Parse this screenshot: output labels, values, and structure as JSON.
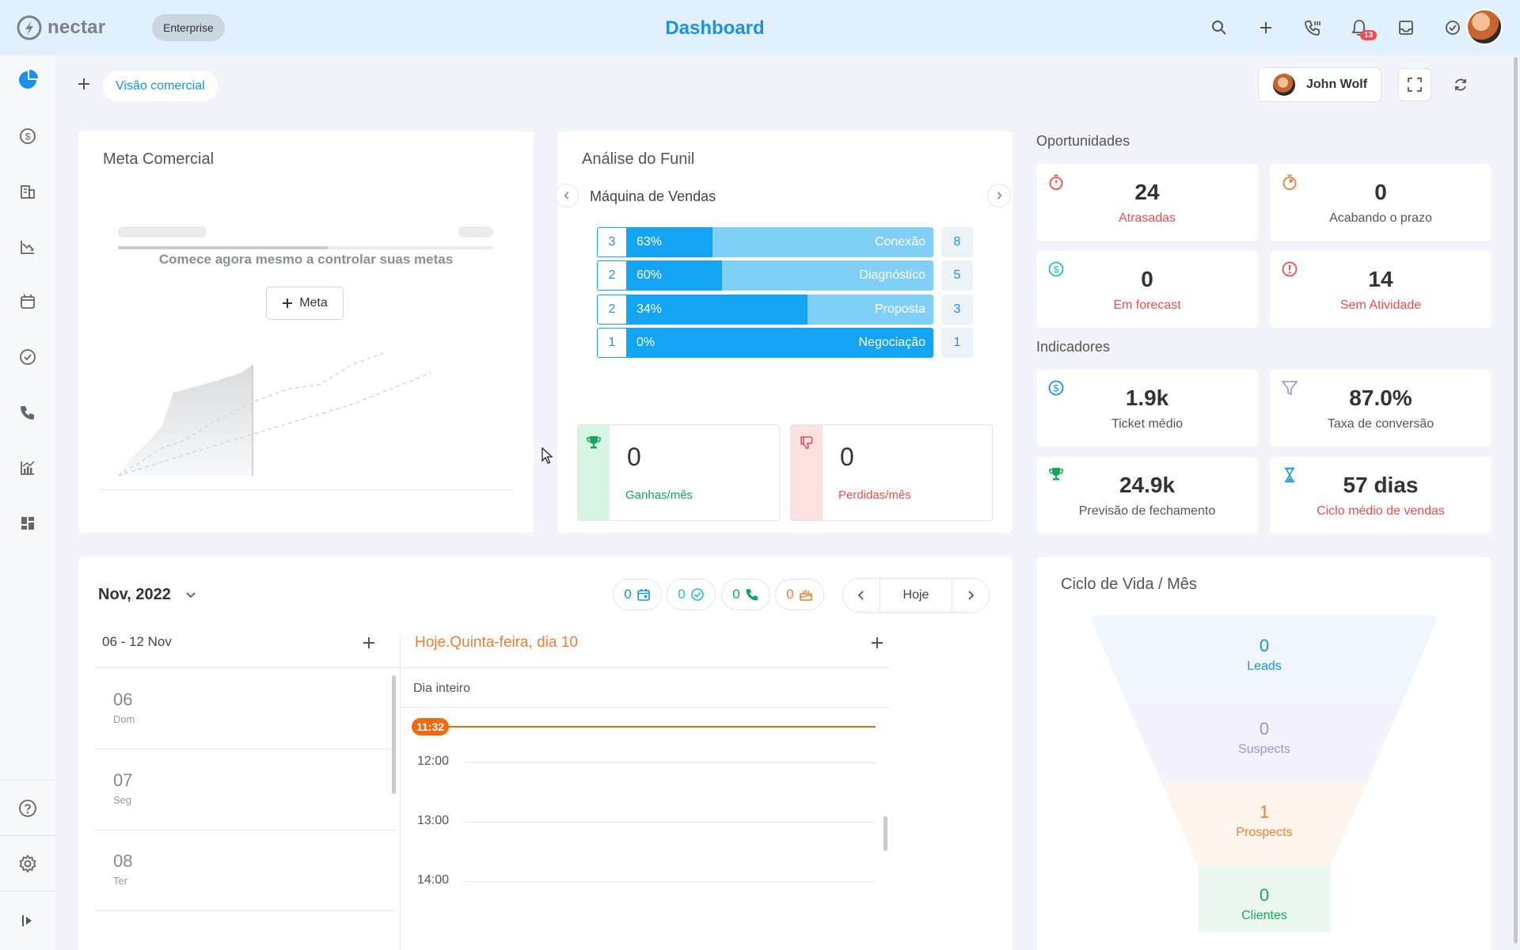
{
  "app": {
    "brand": "nectar",
    "plan_badge": "Enterprise",
    "title": "Dashboard",
    "notifications_count": "13",
    "accent_color": "#1a91e6"
  },
  "toolbar": {
    "tab_label": "Visão comercial",
    "user_name": "John Wolf"
  },
  "sidebar": {
    "items": [
      "pie-chart-icon",
      "dollar-icon",
      "building-icon",
      "chart-down-icon",
      "calendar-icon",
      "check-circle-icon",
      "phone-icon",
      "chart-up-icon",
      "dashboard-icon"
    ],
    "bottom": [
      "help-icon",
      "gear-icon",
      "collapse-icon"
    ]
  },
  "meta_comercial": {
    "title": "Meta Comercial",
    "message": "Comece agora mesmo a controlar suas metas",
    "button_label": "Meta",
    "progress": 0.56
  },
  "funnel": {
    "title": "Análise do Funil",
    "pipeline": "Máquina de Vendas",
    "stages": [
      {
        "num": "3",
        "pct": "63%",
        "fill": 0.28,
        "name": "Conexão",
        "count": "8"
      },
      {
        "num": "2",
        "pct": "60%",
        "fill": 0.31,
        "name": "Diagnóstico",
        "count": "5"
      },
      {
        "num": "2",
        "pct": "34%",
        "fill": 0.59,
        "name": "Proposta",
        "count": "3"
      },
      {
        "num": "1",
        "pct": "0%",
        "fill": 1.0,
        "name": "Negociação",
        "count": "1"
      }
    ],
    "won": {
      "value": "0",
      "label": "Ganhas/mês"
    },
    "lost": {
      "value": "0",
      "label": "Perdidas/mês"
    }
  },
  "oportunidades": {
    "title": "Oportunidades",
    "tiles": [
      {
        "value": "24",
        "label": "Atrasadas",
        "color": "#f04e4e",
        "icon": "timer-icon"
      },
      {
        "value": "0",
        "label": "Acabando o prazo",
        "color": "#555555",
        "icon": "stopwatch-icon"
      },
      {
        "value": "0",
        "label": "Em forecast",
        "color": "#f04e4e",
        "icon": "dollar-circle-icon"
      },
      {
        "value": "14",
        "label": "Sem Atividade",
        "color": "#f04e4e",
        "icon": "alert-icon"
      }
    ]
  },
  "indicadores": {
    "title": "Indicadores",
    "tiles": [
      {
        "value": "1.9k",
        "label": "Ticket médio",
        "color": "#555555",
        "icon": "dollar-circle-icon"
      },
      {
        "value": "87.0%",
        "label": "Taxa de conversão",
        "color": "#555555",
        "icon": "filter-icon"
      },
      {
        "value": "24.9k",
        "label": "Previsão de fechamento",
        "color": "#555555",
        "icon": "trophy-icon"
      },
      {
        "value": "57 dias",
        "label": "Ciclo médio de vendas",
        "color": "#f04e4e",
        "icon": "hourglass-icon"
      }
    ]
  },
  "calendar": {
    "month": "Nov, 2022",
    "counters": [
      {
        "value": "0",
        "icon": "calendar-icon",
        "color": "#1a91e6"
      },
      {
        "value": "0",
        "icon": "check-circle-icon",
        "color": "#21c1b3"
      },
      {
        "value": "0",
        "icon": "phone-icon",
        "color": "#13a85a"
      },
      {
        "value": "0",
        "icon": "cake-icon",
        "color": "#f07d33"
      }
    ],
    "today_button": "Hoje",
    "week_range": "06 - 12 Nov",
    "days": [
      {
        "num": "06",
        "name": "Dom"
      },
      {
        "num": "07",
        "name": "Seg"
      },
      {
        "num": "08",
        "name": "Ter"
      }
    ],
    "today_title": "Hoje.Quinta-feira, dia 10",
    "all_day": "Dia inteiro",
    "now_time": "11:32",
    "hours": [
      "12:00",
      "13:00",
      "14:00"
    ]
  },
  "lifecycle": {
    "title": "Ciclo de Vida / Mês",
    "stages": [
      {
        "value": "0",
        "label": "Leads",
        "color": "#1a91e6"
      },
      {
        "value": "0",
        "label": "Suspects",
        "color": "#9b8ee0"
      },
      {
        "value": "1",
        "label": "Prospects",
        "color": "#f07d33"
      },
      {
        "value": "0",
        "label": "Clientes",
        "color": "#13a85a"
      }
    ]
  }
}
